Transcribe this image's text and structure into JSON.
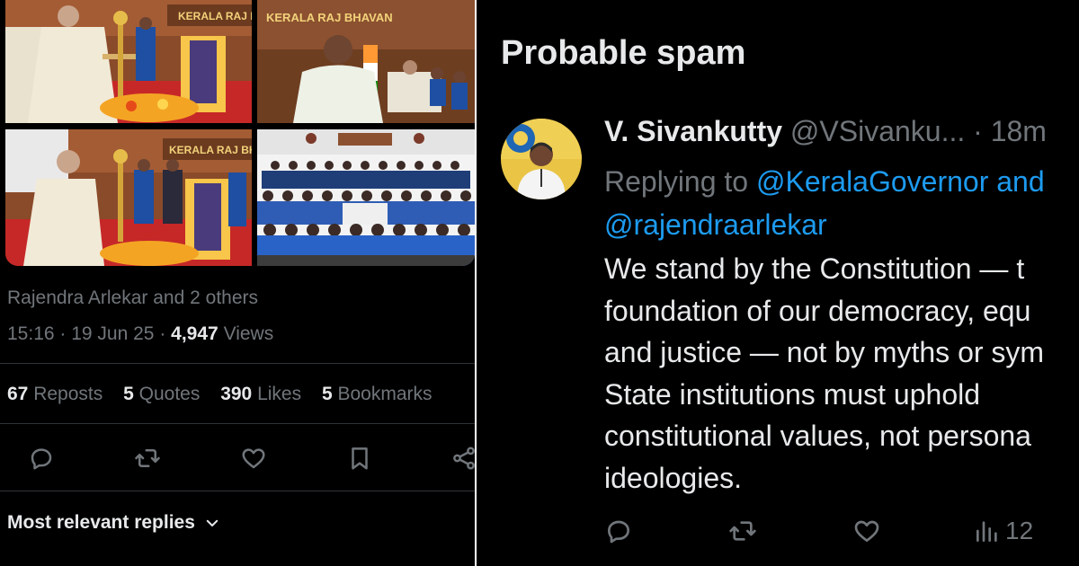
{
  "left_post": {
    "images": [
      {
        "name": "governor-lighting-lamp-photo",
        "banner_text": "KERALA RAJ BHAVAN"
      },
      {
        "name": "minister-speaking-photo",
        "banner_text": "KERALA RAJ BHAVAN"
      },
      {
        "name": "governor-folded-hands-photo",
        "banner_text": "KERALA RAJ BHAVAN"
      },
      {
        "name": "group-photo-students",
        "banner_text": ""
      }
    ],
    "liked_by": "Rajendra Arlekar and 2 others",
    "time": "15:16",
    "date": "19 Jun 25",
    "views_count": "4,947",
    "views_label": "Views",
    "stats": [
      {
        "count": "67",
        "label": "Reposts"
      },
      {
        "count": "5",
        "label": "Quotes"
      },
      {
        "count": "390",
        "label": "Likes"
      },
      {
        "count": "5",
        "label": "Bookmarks"
      }
    ],
    "actions": [
      "reply-icon",
      "repost-icon",
      "like-icon",
      "bookmark-icon",
      "share-icon"
    ],
    "sort_label": "Most relevant replies"
  },
  "right_reply": {
    "section_title": "Probable spam",
    "author_name": "V. Sivankutty",
    "author_handle": "@VSivanku...",
    "timestamp": "· 18m",
    "replying_prefix": "Replying to",
    "replying_to_1": "@KeralaGovernor and",
    "replying_to_2": "@rajendraarlekar",
    "text_lines": [
      "We stand by the Constitution — t",
      "foundation of our democracy, equ",
      "and justice — not by myths or sym",
      "State institutions must uphold",
      "constitutional values, not persona",
      "ideologies."
    ],
    "views_count": "12"
  },
  "colors": {
    "background": "#000000",
    "text_primary": "#e7e9ea",
    "text_secondary": "#71767b",
    "link": "#1d9bf0",
    "divider": "#2f3336"
  }
}
